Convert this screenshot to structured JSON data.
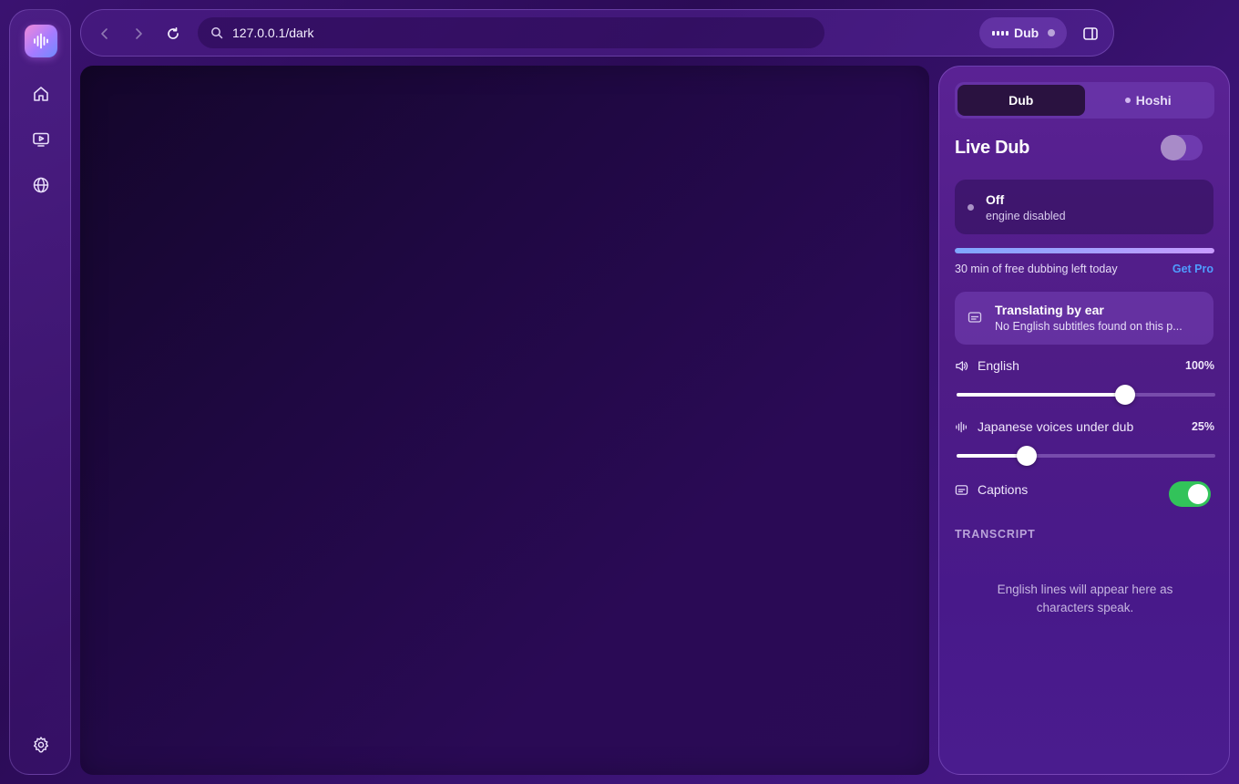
{
  "browser": {
    "url": "127.0.0.1/dark",
    "dub_pill_label": "Dub"
  },
  "panel": {
    "tabs": [
      {
        "label": "Dub",
        "active": true
      },
      {
        "label": "Hoshi",
        "active": false
      }
    ],
    "live_dub": {
      "title": "Live Dub",
      "enabled": false
    },
    "status": {
      "title": "Off",
      "subtitle": "engine disabled"
    },
    "quota": {
      "text": "30 min of free dubbing left today",
      "fill_fraction": 1.0,
      "cta": "Get Pro"
    },
    "info": {
      "title": "Translating by ear",
      "subtitle": "No English subtitles found on this p..."
    },
    "sliders": [
      {
        "label": "English",
        "value_text": "100%",
        "position_fraction": 0.65
      },
      {
        "label": "Japanese voices under dub",
        "value_text": "25%",
        "position_fraction": 0.27
      }
    ],
    "captions": {
      "label": "Captions",
      "enabled": true
    },
    "transcript": {
      "heading": "TRANSCRIPT",
      "empty_text": "English lines will appear here as characters speak."
    }
  },
  "colors": {
    "accent_green": "#32c35a",
    "link_blue": "#4f9dff",
    "background": "#2b0b56"
  },
  "icons": [
    "logo-waveform-icon",
    "home-icon",
    "tv-play-icon",
    "globe-icon",
    "settings-gear-icon",
    "back-arrow-icon",
    "forward-arrow-icon",
    "reload-icon",
    "search-icon",
    "sidebar-toggle-icon",
    "subtitles-icon",
    "speaker-icon",
    "waveform-icon"
  ]
}
